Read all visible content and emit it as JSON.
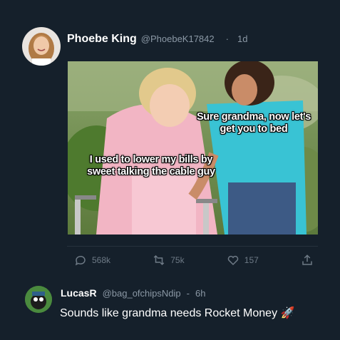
{
  "tweet": {
    "author_name": "Phoebe King",
    "author_handle": "@PhoebeK17842",
    "separator": "·",
    "time": "1d",
    "meme_top_right": "Sure grandma, now let's get you to bed",
    "meme_left": "I used to lower my bills by sweet talking the cable guy",
    "stats": {
      "replies": "568k",
      "retweets": "75k",
      "likes": "157"
    }
  },
  "reply": {
    "author_name": "LucasR",
    "author_handle": "@bag_ofchipsNdip",
    "separator": "-",
    "time": "6h",
    "text": "Sounds like grandma needs Rocket Money 🚀"
  },
  "colors": {
    "background": "#15202b",
    "muted": "#8b98a5",
    "icon": "#6e7a86"
  },
  "icons": [
    "reply-icon",
    "retweet-icon",
    "like-icon",
    "share-icon"
  ]
}
